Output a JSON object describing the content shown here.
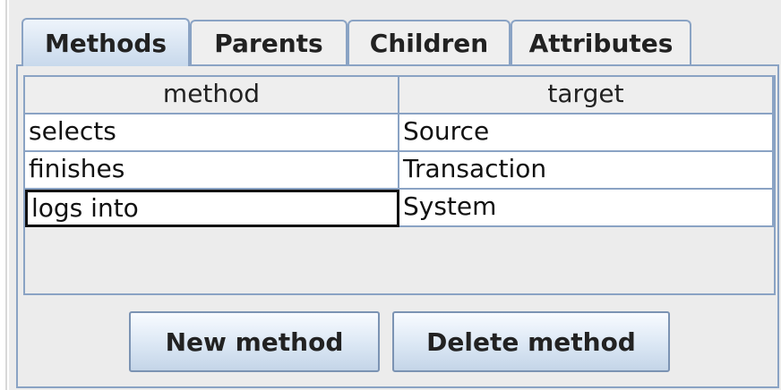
{
  "tabs": [
    {
      "label": "Methods",
      "selected": true
    },
    {
      "label": "Parents",
      "selected": false
    },
    {
      "label": "Children",
      "selected": false
    },
    {
      "label": "Attributes",
      "selected": false
    }
  ],
  "table": {
    "columns": [
      "method",
      "target"
    ],
    "rows": [
      {
        "method": "selects",
        "target": "Source"
      },
      {
        "method": "finishes",
        "target": "Transaction"
      },
      {
        "method": "logs into",
        "target": "System"
      }
    ],
    "focused_cell": {
      "row": 2,
      "column": "method"
    }
  },
  "buttons": {
    "new_method": "New method",
    "delete_method": "Delete method"
  },
  "colors": {
    "border": "#8aa3c4",
    "panel_background": "#ececec",
    "tab_selected": "#c8d9ec"
  }
}
